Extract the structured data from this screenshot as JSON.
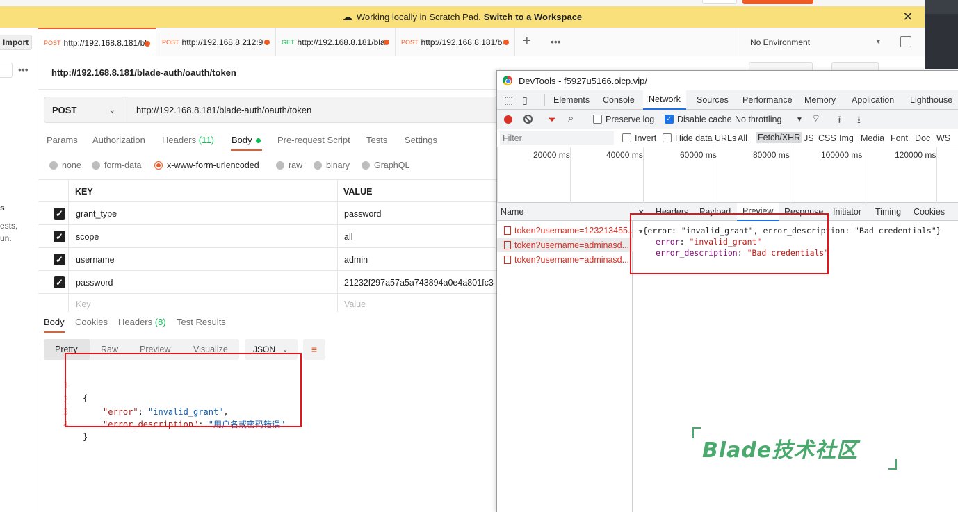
{
  "banner": {
    "text": "Working locally in Scratch Pad.",
    "link": "Switch to a Workspace"
  },
  "left": {
    "import_label": "Import",
    "frag1": "s",
    "frag2": "ests,",
    "frag3": "un."
  },
  "tabs": [
    {
      "method": "POST",
      "url": "http://192.168.8.181/bl"
    },
    {
      "method": "POST",
      "url": "http://192.168.8.212:9"
    },
    {
      "method": "GET",
      "url": "http://192.168.8.181/bla"
    },
    {
      "method": "POST",
      "url": "http://192.168.8.181/bl"
    }
  ],
  "environment": "No Environment",
  "request": {
    "title": "http://192.168.8.181/blade-auth/oauth/token",
    "method": "POST",
    "url": "http://192.168.8.181/blade-auth/oauth/token"
  },
  "req_tabs": {
    "params": "Params",
    "authorization": "Authorization",
    "headers": "Headers",
    "headers_count": "(11)",
    "body": "Body",
    "prerequest": "Pre-request Script",
    "tests": "Tests",
    "settings": "Settings"
  },
  "body_types": [
    "none",
    "form-data",
    "x-www-form-urlencoded",
    "raw",
    "binary",
    "GraphQL"
  ],
  "kv": {
    "key_header": "KEY",
    "value_header": "VALUE",
    "rows": [
      {
        "key": "grant_type",
        "value": "password"
      },
      {
        "key": "scope",
        "value": "all"
      },
      {
        "key": "username",
        "value": "admin"
      },
      {
        "key": "password",
        "value": "21232f297a57a5a743894a0e4a801fc3"
      }
    ],
    "key_placeholder": "Key",
    "value_placeholder": "Value"
  },
  "resp_tabs": {
    "body": "Body",
    "cookies": "Cookies",
    "headers": "Headers",
    "headers_count": "(8)",
    "test_results": "Test Results"
  },
  "view_modes": [
    "Pretty",
    "Raw",
    "Preview",
    "Visualize"
  ],
  "format": "JSON",
  "response_code": {
    "line1": "{",
    "key1": "\"error\"",
    "val1": "\"invalid_grant\"",
    "key2": "\"error_description\"",
    "val2": "\"用户名或密码错误\"",
    "line4": "}",
    "n1": "1",
    "n2": "2",
    "n3": "3",
    "n4": "4"
  },
  "devtools": {
    "title": "DevTools - f5927u5166.oicp.vip/",
    "tabs": [
      "Elements",
      "Console",
      "Network",
      "Sources",
      "Performance",
      "Memory",
      "Application",
      "Lighthouse"
    ],
    "preserve_log": "Preserve log",
    "disable_cache": "Disable cache",
    "throttling": "No throttling",
    "filter_placeholder": "Filter",
    "invert": "Invert",
    "hide_data_urls": "Hide data URLs",
    "types": [
      "All",
      "Fetch/XHR",
      "JS",
      "CSS",
      "Img",
      "Media",
      "Font",
      "Doc",
      "WS"
    ],
    "ticks": [
      "20000 ms",
      "40000 ms",
      "60000 ms",
      "80000 ms",
      "100000 ms",
      "120000 ms"
    ],
    "name_header": "Name",
    "requests": [
      "token?username=123213455...",
      "token?username=adminasd...",
      "token?username=adminasd..."
    ],
    "detail_tabs": [
      "Headers",
      "Payload",
      "Preview",
      "Response",
      "Initiator",
      "Timing",
      "Cookies"
    ],
    "preview": {
      "summary": "{error: \"invalid_grant\", error_description: \"Bad credentials\"}",
      "k1": "error",
      "v1": "\"invalid_grant\"",
      "k2": "error_description",
      "v2": "\"Bad credentials\""
    }
  },
  "watermark": "Blade技术社区",
  "colors": {
    "accent": "#ef5b25",
    "banner": "#f9e07a",
    "highlight": "#e0181b",
    "watermark": "#4aa96c"
  }
}
